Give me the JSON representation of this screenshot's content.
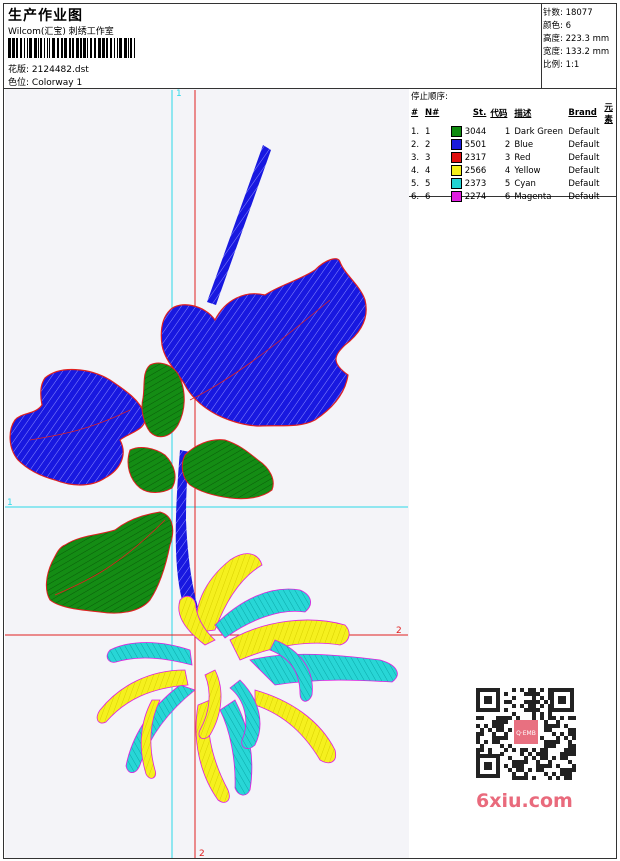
{
  "header": {
    "title": "生产作业图",
    "company": "Wilcom(汇宝) 刺绣工作室",
    "design_label": "花版:",
    "design_value": "2124482.dst",
    "colorway_label": "色位:",
    "colorway_value": "Colorway 1"
  },
  "specs": [
    {
      "label": "针数:",
      "value": "18077"
    },
    {
      "label": "颜色:",
      "value": "6"
    },
    {
      "label": "高度:",
      "value": "223.3 mm"
    },
    {
      "label": "宽度:",
      "value": "133.2 mm"
    },
    {
      "label": "比例:",
      "value": "1:1"
    }
  ],
  "stop_sequence": {
    "title": "停止顺序:",
    "headers": [
      "#",
      "N#",
      "St.",
      "代码",
      "描述",
      "Brand",
      "元素"
    ],
    "rows": [
      {
        "idx": "1.",
        "n": "1",
        "code": "3044",
        "num": "1",
        "desc": "Dark Green",
        "brand": "Default",
        "color": "#0f8a0f"
      },
      {
        "idx": "2.",
        "n": "2",
        "code": "5501",
        "num": "2",
        "desc": "Blue",
        "brand": "Default",
        "color": "#1a1adc"
      },
      {
        "idx": "3.",
        "n": "3",
        "code": "2317",
        "num": "3",
        "desc": "Red",
        "brand": "Default",
        "color": "#e01010"
      },
      {
        "idx": "4.",
        "n": "4",
        "code": "2566",
        "num": "4",
        "desc": "Yellow",
        "brand": "Default",
        "color": "#f2ee1a"
      },
      {
        "idx": "5.",
        "n": "5",
        "code": "2373",
        "num": "5",
        "desc": "Cyan",
        "brand": "Default",
        "color": "#22d4d4"
      },
      {
        "idx": "6.",
        "n": "6",
        "code": "2274",
        "num": "6",
        "desc": "Magenta",
        "brand": "Default",
        "color": "#e01ee0"
      }
    ]
  },
  "canvas_marks": {
    "top": "1",
    "left": "1",
    "right": "2",
    "bottom": "2"
  },
  "watermark": "6xiu.com",
  "qr_label": "Q·EMB"
}
